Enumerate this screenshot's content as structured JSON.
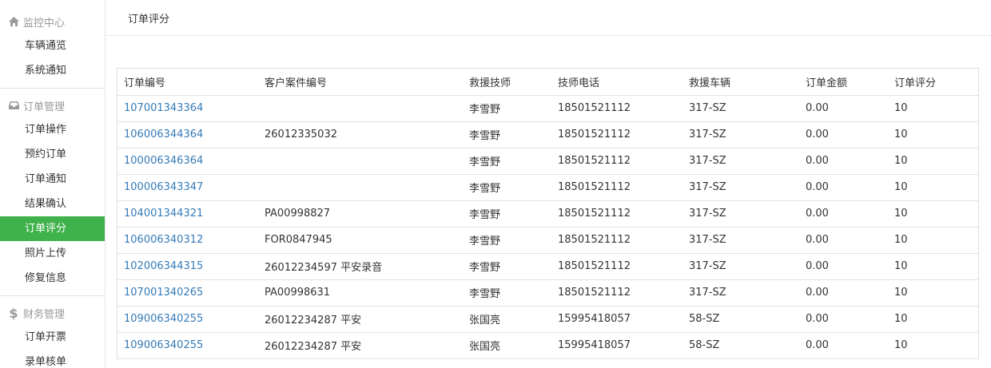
{
  "sidebar": {
    "groups": [
      {
        "title": "监控中心",
        "icon": "home-icon",
        "items": [
          "车辆通览",
          "系统通知"
        ]
      },
      {
        "title": "订单管理",
        "icon": "inbox-icon",
        "items": [
          "订单操作",
          "预约订单",
          "订单通知",
          "结果确认",
          "订单评分",
          "照片上传",
          "修复信息"
        ]
      },
      {
        "title": "财务管理",
        "icon": "dollar-icon",
        "items": [
          "订单开票",
          "录单核单"
        ]
      }
    ],
    "active_item": "订单评分",
    "active_color": "#3fb24b"
  },
  "header": {
    "title": "订单评分"
  },
  "table": {
    "columns": [
      "订单编号",
      "客户案件编号",
      "救援技师",
      "技师电话",
      "救援车辆",
      "订单金额",
      "订单评分"
    ],
    "rows": [
      [
        "107001343364",
        "",
        "李雪野",
        "18501521112",
        "317-SZ",
        "0.00",
        "10"
      ],
      [
        "106006344364",
        "26012335032",
        "李雪野",
        "18501521112",
        "317-SZ",
        "0.00",
        "10"
      ],
      [
        "100006346364",
        "",
        "李雪野",
        "18501521112",
        "317-SZ",
        "0.00",
        "10"
      ],
      [
        "100006343347",
        "",
        "李雪野",
        "18501521112",
        "317-SZ",
        "0.00",
        "10"
      ],
      [
        "104001344321",
        "PA00998827",
        "李雪野",
        "18501521112",
        "317-SZ",
        "0.00",
        "10"
      ],
      [
        "106006340312",
        "FOR0847945",
        "李雪野",
        "18501521112",
        "317-SZ",
        "0.00",
        "10"
      ],
      [
        "102006344315",
        "26012234597 平安录音",
        "李雪野",
        "18501521112",
        "317-SZ",
        "0.00",
        "10"
      ],
      [
        "107001340265",
        "PA00998631",
        "李雪野",
        "18501521112",
        "317-SZ",
        "0.00",
        "10"
      ],
      [
        "109006340255",
        "26012234287 平安",
        "张国亮",
        "15995418057",
        "58-SZ",
        "0.00",
        "10"
      ],
      [
        "109006340255",
        "26012234287 平安",
        "张国亮",
        "15995418057",
        "58-SZ",
        "0.00",
        "10"
      ]
    ],
    "link_color": "#337ab7"
  }
}
